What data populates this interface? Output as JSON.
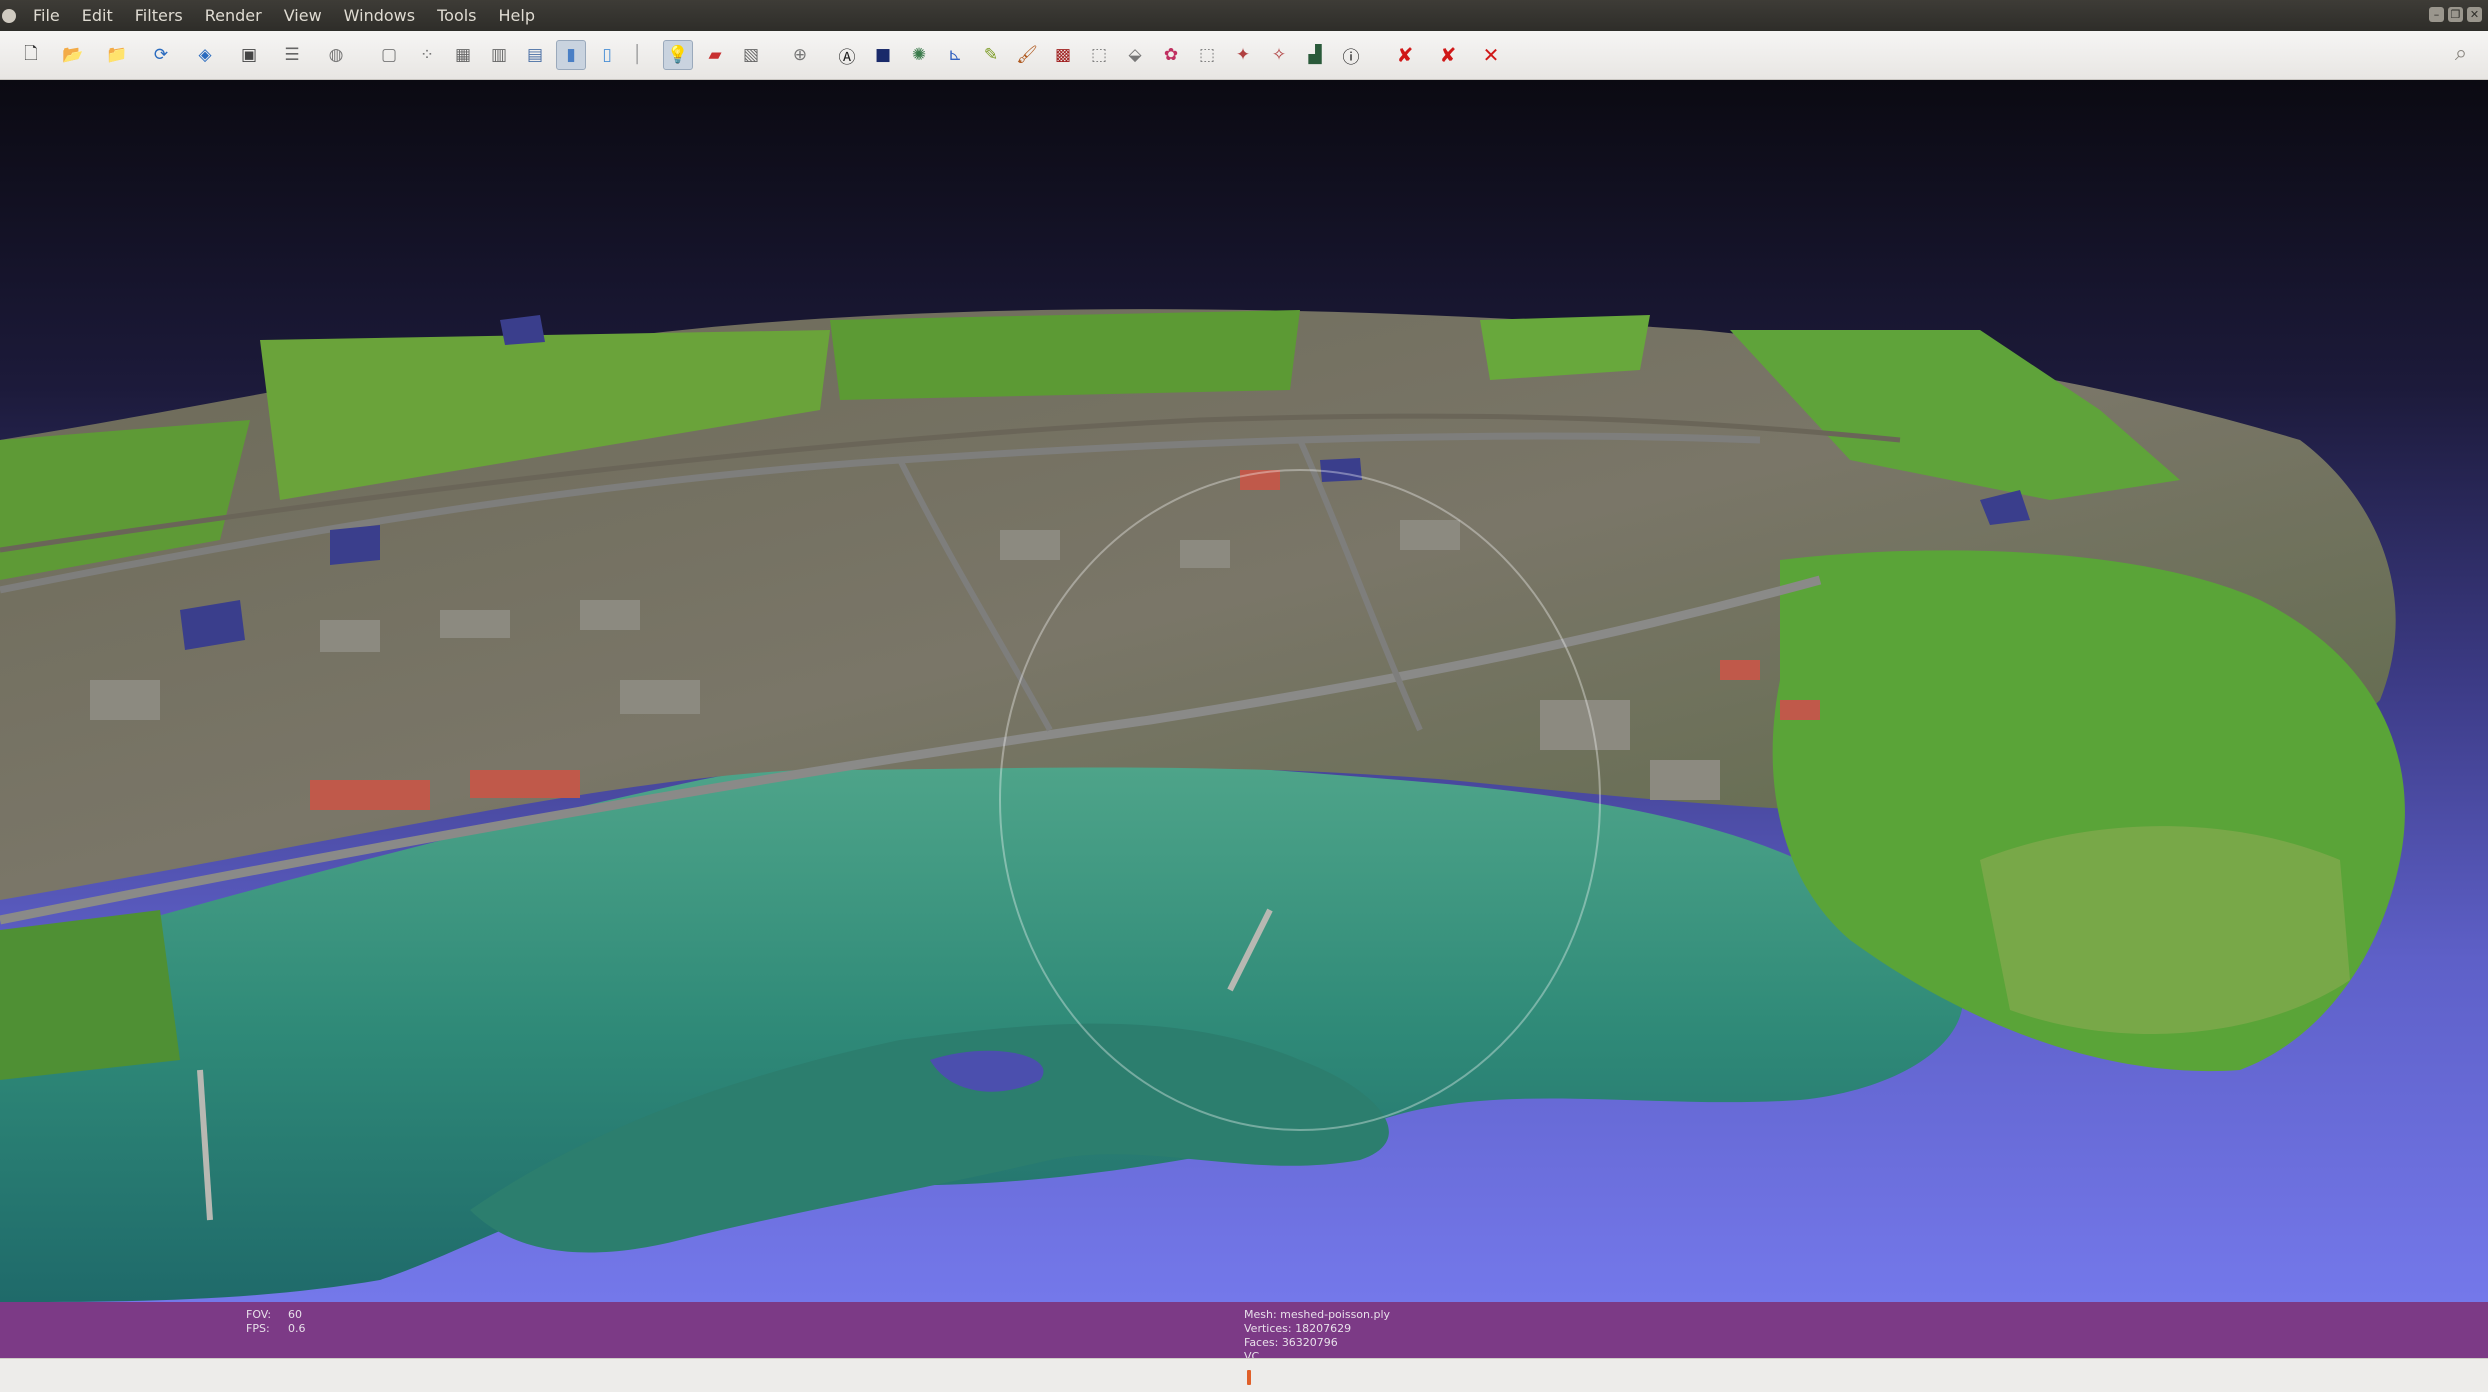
{
  "menubar": {
    "items": [
      {
        "id": "file",
        "label": "File"
      },
      {
        "id": "edit",
        "label": "Edit"
      },
      {
        "id": "filters",
        "label": "Filters"
      },
      {
        "id": "render",
        "label": "Render"
      },
      {
        "id": "view",
        "label": "View"
      },
      {
        "id": "windows",
        "label": "Windows"
      },
      {
        "id": "tools",
        "label": "Tools"
      },
      {
        "id": "help",
        "label": "Help"
      }
    ]
  },
  "toolbar": {
    "icons": [
      "new-project-icon",
      "open-project-icon",
      "open-mesh-icon",
      "reload-icon",
      "save-snapshot-icon",
      "screenshot-icon",
      "layers-icon",
      "mesh-info-icon",
      "bbox-icon",
      "points-icon",
      "wireframe-icon",
      "hidden-lines-icon",
      "flat-lines-icon",
      "flat-icon",
      "smooth-icon",
      "texture-icon",
      "lighting-icon",
      "backface-icon",
      "double-lighting-icon",
      "trackball-icon",
      "annotate-icon",
      "raster-icon",
      "align-icon",
      "measure-icon",
      "pick-points-icon",
      "paint-icon",
      "z-paint-icon",
      "select-faces-icon",
      "select-vertices-icon",
      "select-connected-icon",
      "select-area-icon",
      "edit-reference-icon",
      "edit-manipulator-icon",
      "quality-mapper-icon",
      "info-icon",
      "delete-faces-icon",
      "delete-vertices-icon",
      "delete-all-icon"
    ],
    "active": [
      "smooth-icon",
      "lighting-icon"
    ]
  },
  "viewport": {
    "fov_label": "FOV:",
    "fov_value": "60",
    "fps_label": "FPS:",
    "fps_value": "0.6",
    "mesh_label": "Mesh:",
    "mesh_value": "meshed-poisson.ply",
    "vertices_label": "Vertices:",
    "vertices_value": "18207629",
    "faces_label": "Faces:",
    "faces_value": "36320796",
    "color_mode": "VC"
  },
  "colors": {
    "infobar": "#7c3a86",
    "progress": "#e0602a",
    "background_top": "#0b0a12",
    "background_bottom": "#7478ea"
  }
}
